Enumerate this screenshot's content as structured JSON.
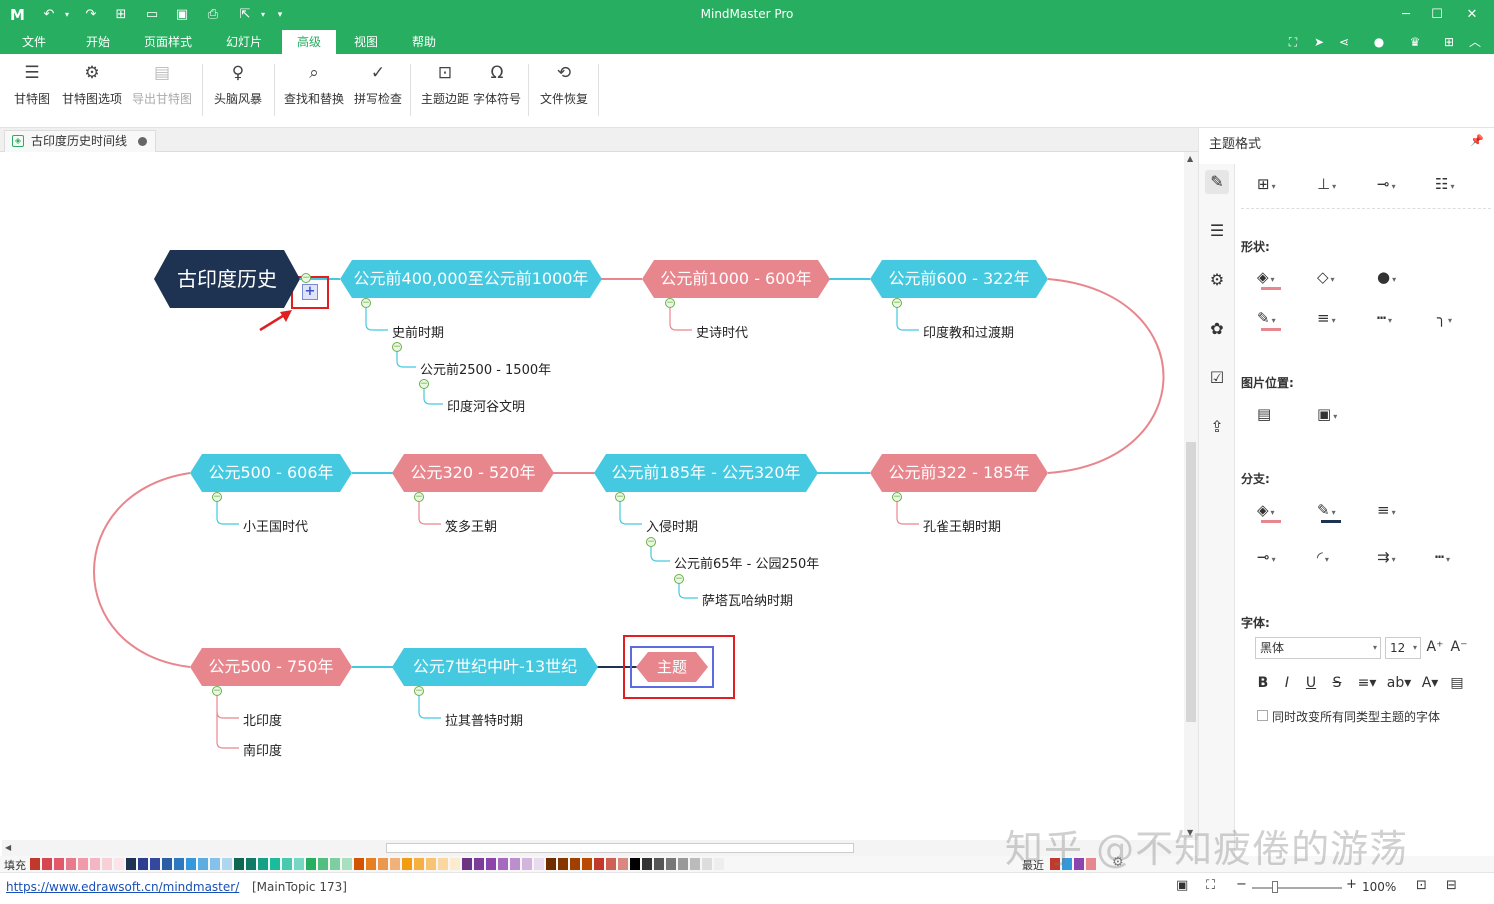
{
  "app": {
    "title": "MindMaster Pro",
    "logo": "M",
    "accent": "#27ae60"
  },
  "menu": [
    "文件",
    "开始",
    "页面样式",
    "幻灯片",
    "高级",
    "视图",
    "帮助"
  ],
  "ribbon": {
    "gantt": "甘特图",
    "gantt_options": "甘特图选项",
    "export_gantt": "导出甘特图",
    "brainstorm": "头脑风暴",
    "find_replace": "查找和替换",
    "spellcheck": "拼写检查",
    "topic_margin": "主题边距",
    "symbols": "字体符号",
    "file_recovery": "文件恢复"
  },
  "document_tab": "古印度历史时间线",
  "map": {
    "central": "古印度历史",
    "topics": {
      "t1": "公元前400,000至公元前1000年",
      "t2": "公元前1000 - 600年",
      "t3": "公元前600 - 322年",
      "t4": "公元前322 - 185年",
      "t5": "公元前185年 - 公元320年",
      "t6": "公元320 - 520年",
      "t7": "公元500 - 606年",
      "t8": "公元500 - 750年",
      "t9": "公元7世纪中叶-13世纪",
      "t10": "主题"
    },
    "subtopics": {
      "s1": "史前时期",
      "s1a": "公元前2500 - 1500年",
      "s1b": "印度河谷文明",
      "s2": "史诗时代",
      "s3": "印度教和过渡期",
      "s4": "孔雀王朝时期",
      "s5": "入侵时期",
      "s5a": "公元前65年 - 公园250年",
      "s5b": "萨塔瓦哈纳时期",
      "s6": "笈多王朝",
      "s7": "小王国时代",
      "s8a": "北印度",
      "s8b": "南印度",
      "s9": "拉其普特时期"
    },
    "colors": {
      "cyan": "#45c9e0",
      "pink": "#e8868e",
      "navy": "#1e3252",
      "highlight": "#e02020"
    }
  },
  "panel": {
    "title": "主题格式",
    "shape_label": "形状:",
    "image_pos_label": "图片位置:",
    "branch_label": "分支:",
    "font_label": "字体:",
    "font_family": "黑体",
    "font_size": "12",
    "apply_same_type": "同时改变所有同类型主题的字体"
  },
  "palette": {
    "fill_label": "填充",
    "recent_label": "最近"
  },
  "status": {
    "url": "https://www.edrawsoft.cn/mindmaster/",
    "topic_info": "[MainTopic 173]",
    "zoom": "100%"
  },
  "watermark": "知乎 @不知疲倦的游荡"
}
